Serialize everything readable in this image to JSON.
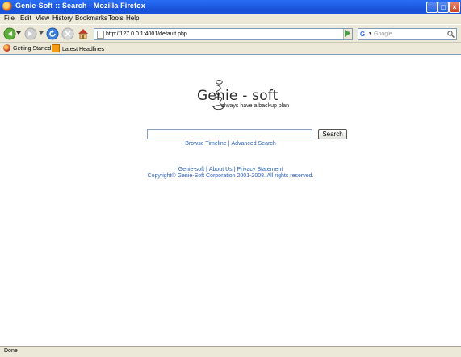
{
  "window": {
    "title": "Genie-Soft :: Search - Mozilla Firefox",
    "minimize_glyph": "_",
    "maximize_glyph": "□",
    "close_glyph": "×"
  },
  "menu": [
    "File",
    "Edit",
    "View",
    "History",
    "Bookmarks",
    "Tools",
    "Help"
  ],
  "navbar": {
    "url": "http://127.0.0.1:4001/default.php",
    "search_placeholder": "Google",
    "search_engine_glyph": "G"
  },
  "bookmarks": [
    "Getting Started",
    "Latest Headlines"
  ],
  "page": {
    "brand": "Genie - soft",
    "tagline": "always have a backup plan",
    "search_value": "",
    "search_button": "Search",
    "links": [
      "Browse Timeline",
      "Advanced Search"
    ],
    "footer_links": [
      "Genie-soft",
      "About Us",
      "Privacy Statement"
    ],
    "copyright": "Copyright© Genie-Soft Corporation 2001-2008. All rights reserved."
  },
  "status": "Done",
  "colors": {
    "titlebar": "#1f5ee6",
    "chrome": "#ece9d8",
    "link": "#2a5fb5"
  }
}
